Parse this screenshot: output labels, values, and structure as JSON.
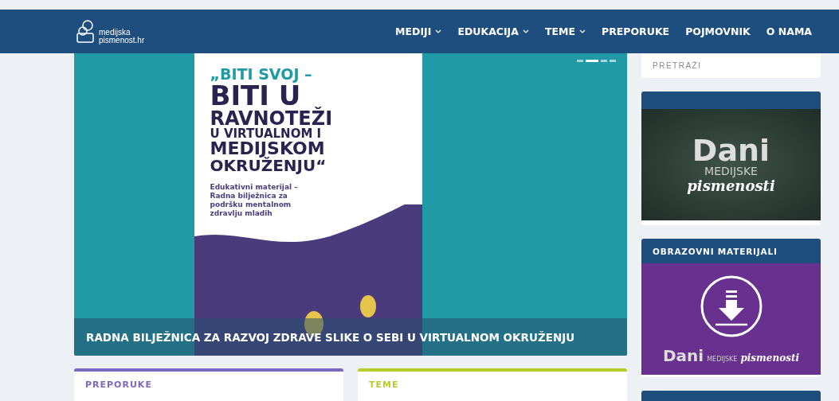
{
  "header": {
    "logo": "medijska\npismenost.hr",
    "nav": [
      {
        "label": "MEDIJI",
        "dropdown": true
      },
      {
        "label": "EDUKACIJA",
        "dropdown": true
      },
      {
        "label": "TEME",
        "dropdown": true
      },
      {
        "label": "PREPORUKE",
        "dropdown": false
      },
      {
        "label": "POJMOVNIK",
        "dropdown": false
      },
      {
        "label": "O NAMA",
        "dropdown": false
      }
    ]
  },
  "slider": {
    "slides": [
      {
        "selected": false
      },
      {
        "selected": true
      },
      {
        "selected": false
      },
      {
        "selected": false
      }
    ],
    "cover": {
      "kicker": "„BITI SVOJ –",
      "title": [
        "BITI U",
        "RAVNOTEŽI",
        "U VIRTUALNOM I",
        "MEDIJSKOM",
        "OKRUŽENJU“"
      ],
      "subtitle": "Edukativni materijal –\nRadna bilježnica za\npodršku mentalnom\nzdravlju mladih"
    },
    "caption": "RADNA BILJEŽNICA ZA RAZVOJ ZDRAVE SLIKE O SEBI U VIRTUALNOM OKRUŽENJU"
  },
  "sections": [
    {
      "title": "PREPORUKE",
      "color": "#7b68c2"
    },
    {
      "title": "TEME",
      "color": "#b9cc2e"
    }
  ],
  "sidebar": {
    "search": {
      "placeholder": "PRETRAŽI"
    },
    "widgets": [
      {
        "kind": "chalkboard",
        "big": "Dani",
        "middle": "MEDIJSKE",
        "script": "pismenosti"
      },
      {
        "kind": "download",
        "title": "OBRAZOVNI MATERIJALI",
        "big": "Dani",
        "middle": "MEDIJSKE",
        "script": "pismenosti"
      },
      {
        "kind": "empty"
      }
    ]
  }
}
